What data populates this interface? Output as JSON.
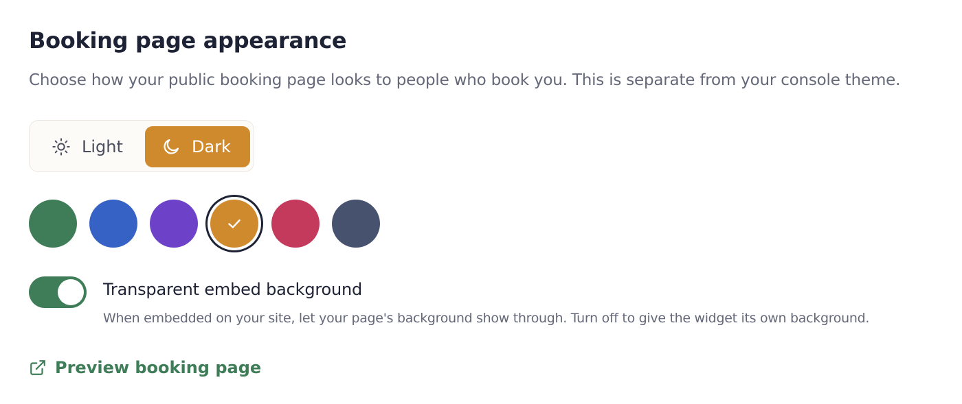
{
  "section": {
    "title": "Booking page appearance",
    "description": "Choose how your public booking page looks to people who book you. This is separate from your console theme."
  },
  "mode_toggle": {
    "options": [
      {
        "label": "Light",
        "icon": "sun-icon",
        "selected": false
      },
      {
        "label": "Dark",
        "icon": "moon-icon",
        "selected": true
      }
    ],
    "selected_color": "#d08a2e"
  },
  "accent_colors": {
    "swatches": [
      {
        "color": "#3e7d57",
        "selected": false
      },
      {
        "color": "#3562c4",
        "selected": false
      },
      {
        "color": "#6d42c8",
        "selected": false
      },
      {
        "color": "#d08a2e",
        "selected": true
      },
      {
        "color": "#c43a5c",
        "selected": false
      },
      {
        "color": "#47536e",
        "selected": false
      }
    ],
    "selected_icon": "check-icon"
  },
  "embed_background": {
    "label": "Transparent embed background",
    "description": "When embedded on your site, let your page's background show through. Turn off to give the widget its own background.",
    "enabled": true,
    "on_color": "#3e7d57"
  },
  "preview": {
    "label": "Preview booking page",
    "icon": "external-link-icon",
    "color": "#3e7d57"
  }
}
